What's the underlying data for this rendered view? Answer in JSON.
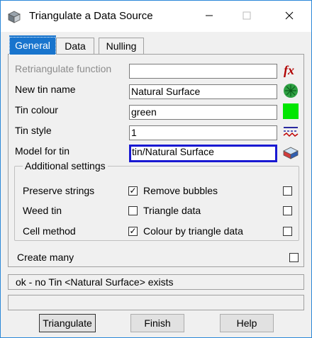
{
  "window": {
    "title": "Triangulate a Data Source",
    "icons": {
      "app": "app-icon",
      "minimize": "minimize-icon",
      "maximize": "maximize-icon",
      "close": "close-icon"
    }
  },
  "tabs": [
    {
      "label": "General",
      "active": true
    },
    {
      "label": "Data",
      "active": false
    },
    {
      "label": "Nulling",
      "active": false
    }
  ],
  "form": {
    "retriangulate_function": {
      "label": "Retriangulate function",
      "value": "",
      "icon": "function-icon"
    },
    "new_tin_name": {
      "label": "New tin name",
      "value": "Natural Surface",
      "icon": "tin-leaf-icon"
    },
    "tin_colour": {
      "label": "Tin colour",
      "value": "green",
      "swatch": "#00e600"
    },
    "tin_style": {
      "label": "Tin style",
      "value": "1",
      "icon": "linestyle-icon"
    },
    "model_for_tin": {
      "label": "Model for tin",
      "value": "tin/Natural Surface",
      "icon": "model-layers-icon"
    }
  },
  "additional_settings": {
    "title": "Additional settings",
    "rows": [
      {
        "label": "Preserve strings",
        "left_checked": true,
        "option": "Remove bubbles",
        "right_checked": false
      },
      {
        "label": "Weed tin",
        "left_checked": false,
        "option": "Triangle data",
        "right_checked": false
      },
      {
        "label": "Cell method",
        "left_checked": true,
        "option": "Colour by triangle data",
        "right_checked": false
      }
    ]
  },
  "create_many": {
    "label": "Create many",
    "checked": false
  },
  "status": {
    "message": "ok - no Tin <Natural Surface> exists",
    "secondary": ""
  },
  "buttons": {
    "triangulate": "Triangulate",
    "finish": "Finish",
    "help": "Help"
  },
  "colors": {
    "accent": "#1874cd",
    "focus_border": "#1919d2",
    "tab_active_bg": "#1874cd"
  }
}
